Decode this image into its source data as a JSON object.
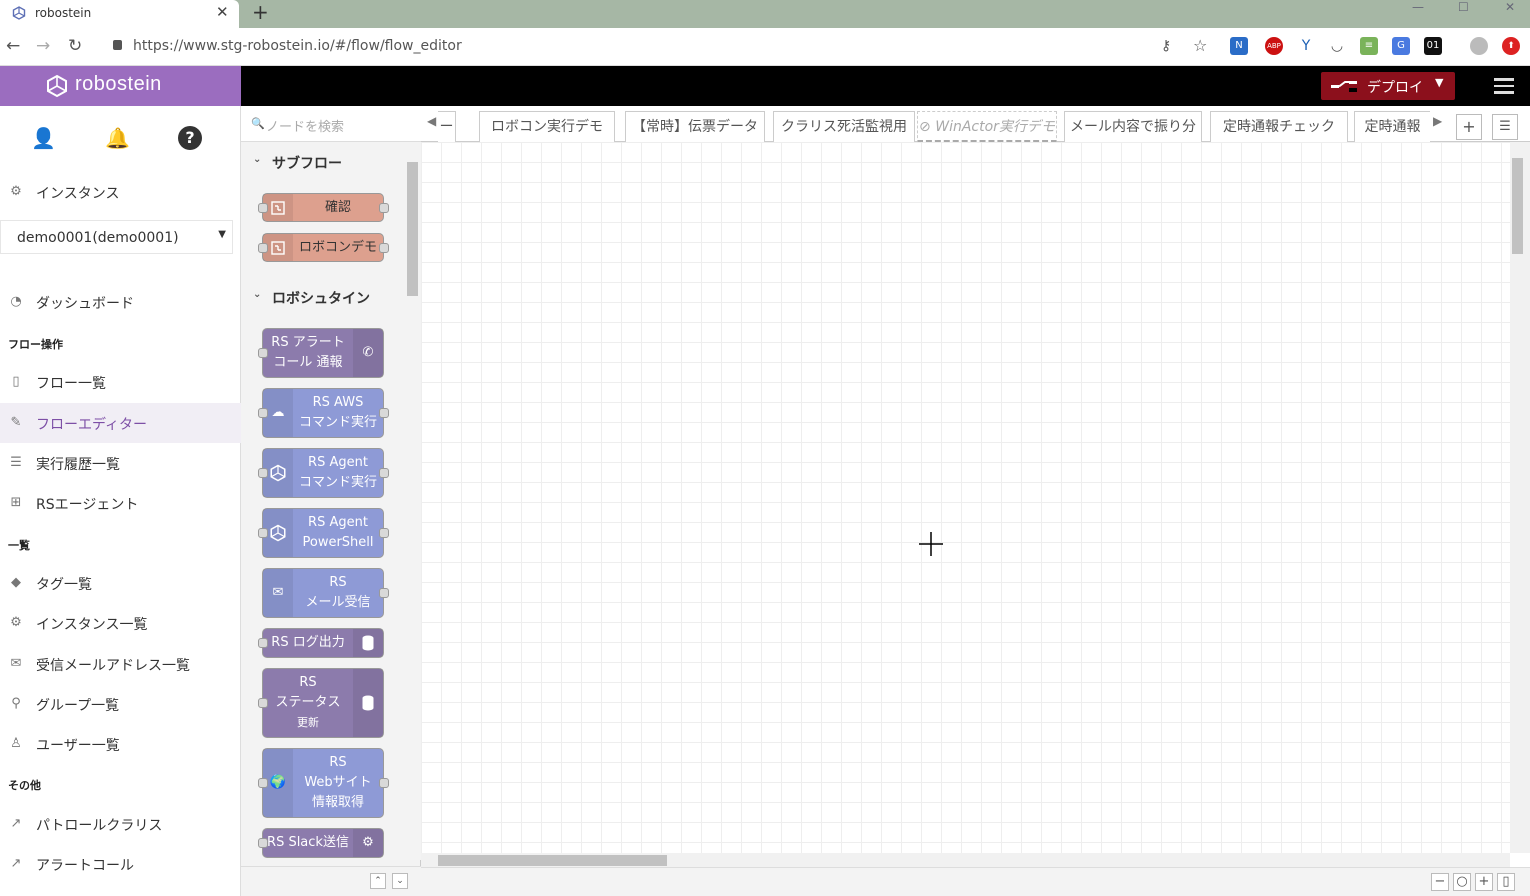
{
  "browser": {
    "tab_title": "robostein",
    "url": "https://www.stg-robostein.io/#/flow/flow_editor"
  },
  "brand": {
    "name": "robostein",
    "color": "#9b6dbf"
  },
  "sidebar": {
    "instances_label": "インスタンス",
    "instance_selected": "demo0001(demo0001)",
    "dashboard": "ダッシュボード",
    "section_flow": "フロー操作",
    "flow_list": "フロー一覧",
    "flow_editor": "フローエディター",
    "exec_history": "実行履歴一覧",
    "agent": "RSエージェント",
    "section_list": "一覧",
    "tags": "タグ一覧",
    "instance_list": "インスタンス一覧",
    "mail_list": "受信メールアドレス一覧",
    "groups": "グループ一覧",
    "users": "ユーザー一覧",
    "section_other": "その他",
    "patrol": "パトロールクラリス",
    "alert": "アラートコール"
  },
  "header": {
    "deploy_label": "デプロイ",
    "deploy_color": "#8c101c"
  },
  "palette": {
    "search_placeholder": "ノードを検索",
    "cat_subflow": "サブフロー",
    "cat_robostein": "ロボシュタイン",
    "nodes": {
      "n1": "確認",
      "n2": "ロボコンデモ",
      "n3a": "RS アラート",
      "n3b": "コール 通報",
      "n4a": "RS AWS",
      "n4b": "コマンド実行",
      "n5a": "RS Agent",
      "n5b": "コマンド実行",
      "n6a": "RS Agent",
      "n6b": "PowerShell",
      "n7a": "RS",
      "n7b": "メール受信",
      "n8": "RS ログ出力",
      "n9a": "RS",
      "n9b": "ステータス",
      "n9c": "更新",
      "n10a": "RS",
      "n10b": "Webサイト",
      "n10c": "情報取得",
      "n11": "RS Slack送信"
    }
  },
  "workspace_tabs": {
    "t0": "ー",
    "t1": "ロボコン実行デモ",
    "t2": "【常時】伝票データ",
    "t3": "クラリス死活監視用",
    "t4": "WinActor実行デモ",
    "t5": "メール内容で振り分",
    "t6": "定時通報チェック",
    "t7": "定時通報"
  }
}
